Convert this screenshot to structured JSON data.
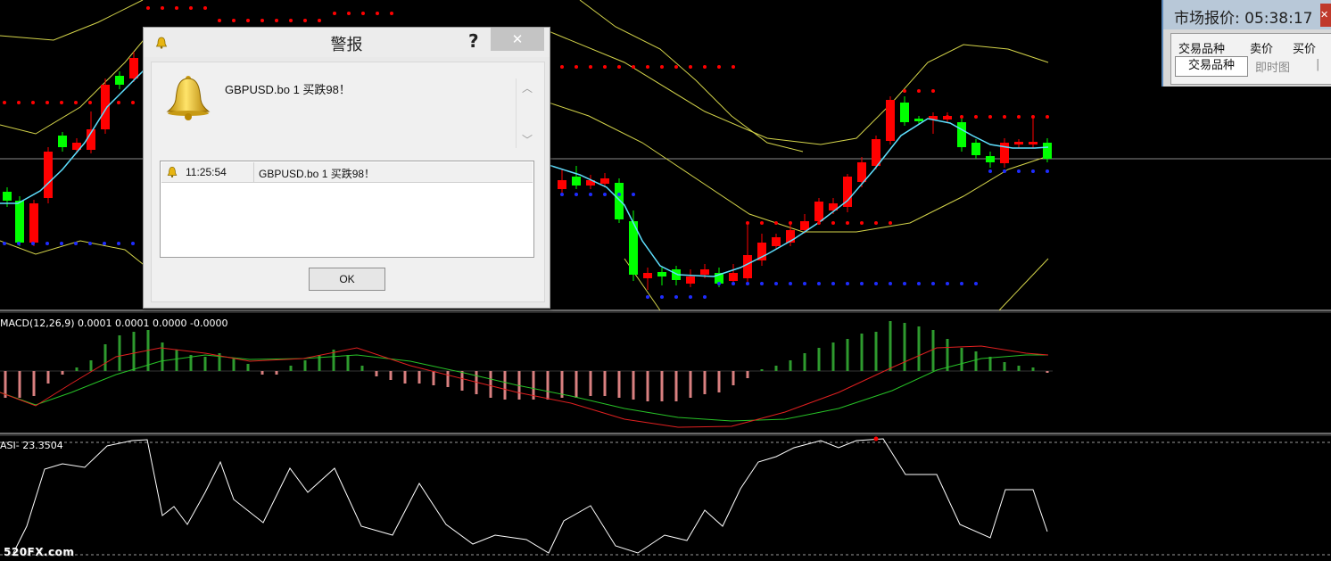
{
  "chart": {
    "macd_label": "MACD(12,26,9) 0.0001 0.0001 0.0000 -0.0000",
    "asi_label": "ASI- 23.3504",
    "watermark": "520FX.com",
    "colors": {
      "bull": "#00ff00",
      "bear": "#ff0000",
      "ma": "#5ee0ff",
      "band": "#d4d44a",
      "sar_red": "#ff0000",
      "sar_blue": "#1e2cff",
      "hist_pos": "#2e9a2e",
      "hist_neg": "#d98080",
      "macd_line": "#e02020",
      "signal_line": "#27c227",
      "asi_line": "#ffffff"
    }
  },
  "alert": {
    "title": "警报",
    "help": "?",
    "close": "✕",
    "message": "GBPUSD.bo 1 买跌98！",
    "list": [
      {
        "time": "11:25:54",
        "message": "GBPUSD.bo 1 买跌98！"
      }
    ],
    "ok_label": "OK"
  },
  "market_watch": {
    "title": "市场报价: 05:38:17",
    "columns": [
      "交易品种",
      "卖价",
      "买价"
    ],
    "tabs": {
      "active": "交易品种",
      "inactive": "即时图"
    }
  }
}
